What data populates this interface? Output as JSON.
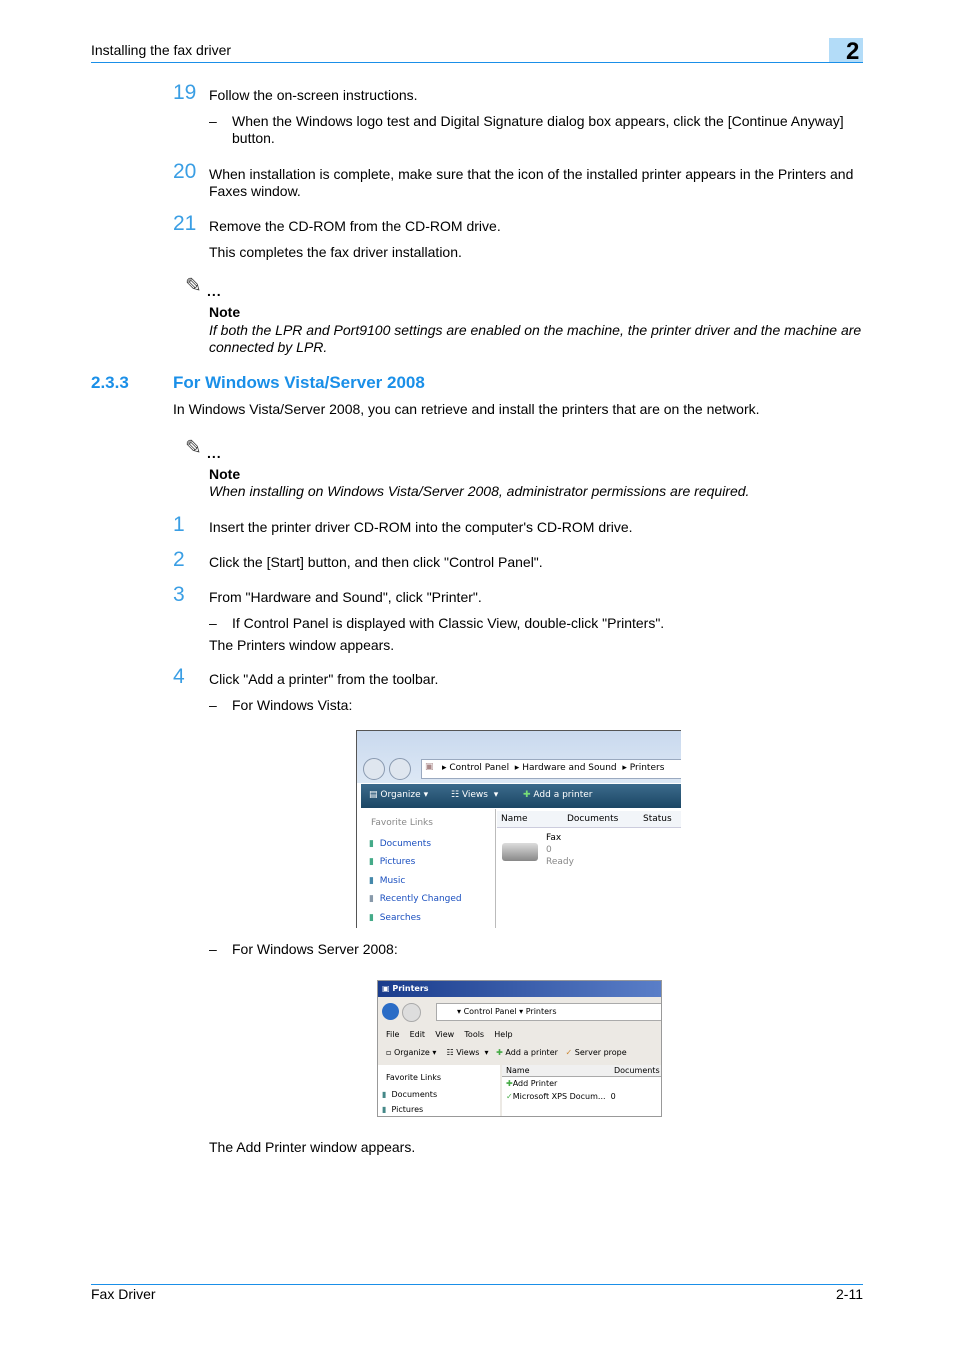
{
  "header": {
    "title": "Installing the fax driver",
    "chapter": "2"
  },
  "steps_a": [
    {
      "num": "19",
      "text": "Follow the on-screen instructions.",
      "sub": "When the Windows logo test and Digital Signature dialog box appears, click the [Continue Anyway] button."
    },
    {
      "num": "20",
      "text": "When installation is complete, make sure that the icon of the installed printer appears in the Printers and Faxes window."
    },
    {
      "num": "21",
      "text": "Remove the CD-ROM from the CD-ROM drive.",
      "after": "This completes the fax driver installation."
    }
  ],
  "note1": {
    "title": "Note",
    "text": "If both the LPR and Port9100 settings are enabled on the machine, the printer driver and the machine are connected by LPR."
  },
  "section": {
    "number": "2.3.3",
    "title": "For Windows Vista/Server 2008",
    "intro": "In Windows Vista/Server 2008, you can retrieve and install the printers that are on the network."
  },
  "note2": {
    "title": "Note",
    "text": "When installing on Windows Vista/Server 2008, administrator permissions are required."
  },
  "steps_b": [
    {
      "num": "1",
      "text": "Insert the printer driver CD-ROM into the computer's CD-ROM drive."
    },
    {
      "num": "2",
      "text": "Click the [Start] button, and then click \"Control Panel\"."
    },
    {
      "num": "3",
      "text": "From \"Hardware and Sound\", click \"Printer\".",
      "sub": "If Control Panel is displayed with Classic View, double-click \"Printers\".",
      "after": "The Printers window appears."
    },
    {
      "num": "4",
      "text": "Click \"Add a printer\" from the toolbar.",
      "sub": "For Windows Vista:",
      "sub2": "For Windows Server 2008:",
      "after": "The Add Printer window appears."
    }
  ],
  "vista": {
    "crumbs": [
      "Control Panel",
      "Hardware and Sound",
      "Printers"
    ],
    "toolbar": [
      "Organize",
      "Views",
      "Add a printer"
    ],
    "fav_title": "Favorite Links",
    "links": [
      "Documents",
      "Pictures",
      "Music",
      "Recently Changed",
      "Searches"
    ],
    "columns": [
      "Name",
      "Documents",
      "Status"
    ],
    "item": {
      "name": "Fax",
      "docs": "0",
      "status": "Ready"
    }
  },
  "server": {
    "title": "Printers",
    "crumbs": [
      "Control Panel",
      "Printers"
    ],
    "menu": [
      "File",
      "Edit",
      "View",
      "Tools",
      "Help"
    ],
    "toolbar": [
      "Organize",
      "Views",
      "Add a printer",
      "Server prope"
    ],
    "fav_title": "Favorite Links",
    "links": [
      "Documents",
      "Pictures"
    ],
    "columns": [
      "Name",
      "Documents"
    ],
    "items": [
      {
        "name": "Add Printer",
        "docs": ""
      },
      {
        "name": "Microsoft XPS Docum...",
        "docs": "0"
      }
    ]
  },
  "footer": {
    "left": "Fax Driver",
    "right": "2-11"
  },
  "dash": "–",
  "note_dots": "..."
}
